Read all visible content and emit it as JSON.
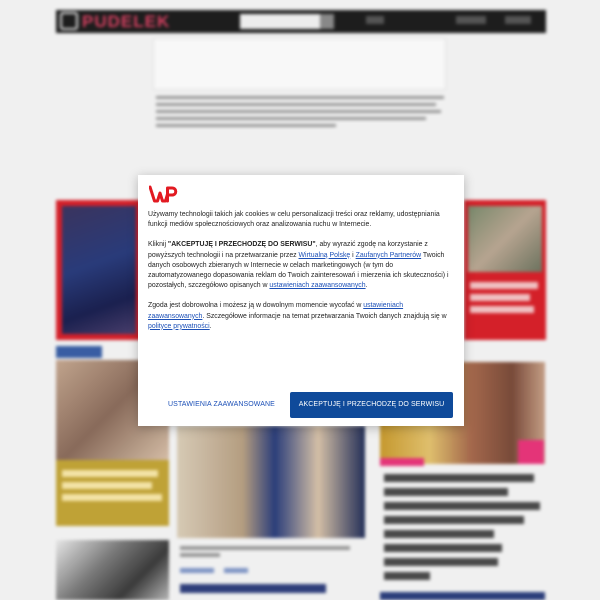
{
  "site": {
    "logo_text": "PUDELEK"
  },
  "consent": {
    "p1": "Używamy technologii takich jak cookies w celu personalizacji treści oraz reklamy, udostępniania funkcji mediów społecznościowych oraz analizowania ruchu w Internecie.",
    "p2": {
      "t1": "Kliknij ",
      "bold": "\"AKCEPTUJĘ I PRZECHODZĘ DO SERWISU\"",
      "t2": ", aby wyrazić zgodę na korzystanie z powyższych technologii i na przetwarzanie przez ",
      "link1": "Wirtualną Polskę",
      "t3": " i ",
      "link2": "Zaufanych Partnerów",
      "t4": " Twoich danych osobowych zbieranych w Internecie w celach marketingowych (w tym do zautomatyzowanego dopasowania reklam do Twoich zainteresowań i mierzenia ich skuteczności) i pozostałych, szczegółowo opisanych w ",
      "link3": "ustawieniach zaawansowanych",
      "t5": "."
    },
    "p3": {
      "t1": "Zgoda jest dobrowolna i możesz ją w dowolnym momencie wycofać w ",
      "link1": "ustawieniach zaawansowanych",
      "t2": ". Szczegółowe informacje na temat przetwarzania Twoich danych znajdują się w ",
      "link2": "polityce prywatności",
      "t3": "."
    },
    "settings_button": "USTAWIENIA ZAAWANSOWANE",
    "accept_button": "AKCEPTUJĘ I PRZECHODZĘ DO SERWISU"
  },
  "colors": {
    "accept_bg": "#0f4a9a",
    "link": "#1c50b7",
    "wp_red": "#e21a22",
    "site_red": "#d7212a"
  },
  "icons": {
    "wp_logo": "wp-logo-icon",
    "site_logo": "pudelek-logo-icon"
  }
}
